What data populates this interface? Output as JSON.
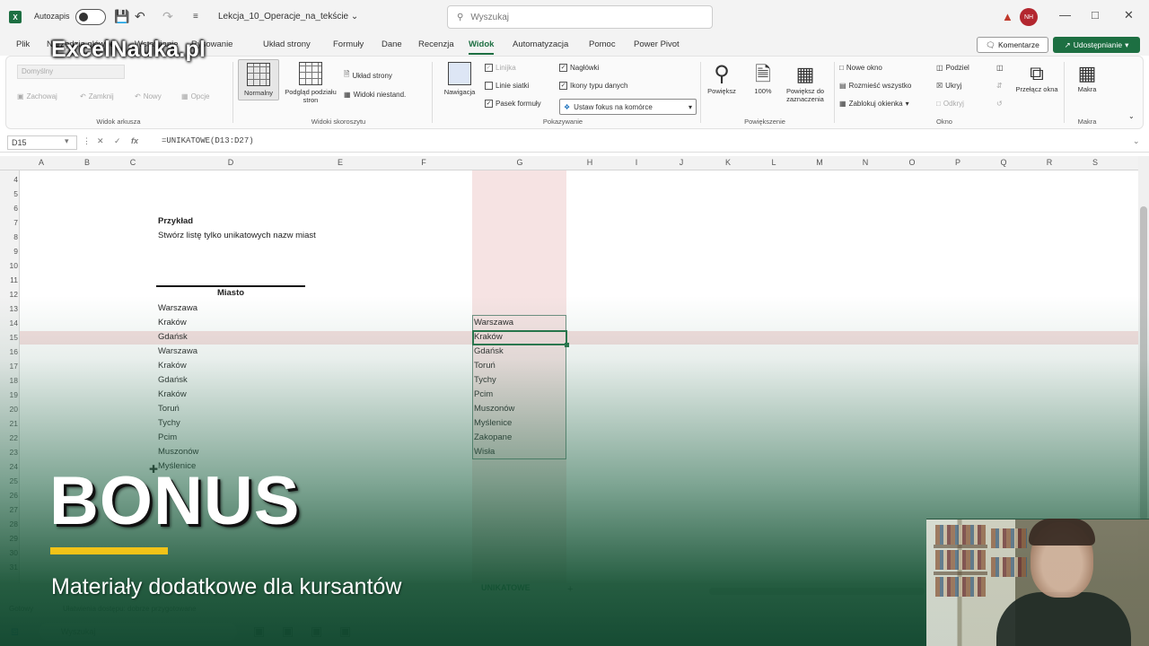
{
  "titlebar": {
    "autosave_label": "Autozapis",
    "filename": "Lekcja_10_Operacje_na_tekście ⌄",
    "search_placeholder": "Wyszukaj",
    "avatar_initials": "NH"
  },
  "tabs": [
    "Plik",
    "Narzędzia główne",
    "Wstawianie",
    "Rysowanie",
    "Układ strony",
    "Formuły",
    "Dane",
    "Recenzja",
    "Widok",
    "Automatyzacja",
    "Pomoc",
    "Power Pivot"
  ],
  "active_tab": "Widok",
  "actions": {
    "comments": "Komentarze",
    "share": "Udostępnianie"
  },
  "ribbon": {
    "sheet_view": {
      "dropdown": "Domyślny",
      "keep": "Zachowaj",
      "exit": "Zamknij",
      "new": "Nowy",
      "options": "Opcje",
      "label": "Widok arkusza"
    },
    "workbook_views": {
      "normal": "Normalny",
      "page_break": "Podgląd podziału stron",
      "page_layout": "Układ strony",
      "custom": "Widoki niestand.",
      "label": "Widoki skoroszytu"
    },
    "show": {
      "navigation": "Nawigacja",
      "ruler": "Linijka",
      "gridlines": "Linie siatki",
      "formula_bar": "Pasek formuły",
      "headings": "Nagłówki",
      "data_type_icons": "Ikony typu danych",
      "focus_cell": "Ustaw fokus na komórce",
      "label": "Pokazywanie"
    },
    "zoom": {
      "zoom": "Powiększ",
      "hundred": "100%",
      "to_selection": "Powiększ do zaznaczenia",
      "label": "Powiększenie"
    },
    "window": {
      "new_window": "Nowe okno",
      "arrange_all": "Rozmieść wszystko",
      "freeze_panes": "Zablokuj okienka",
      "split": "Podziel",
      "hide": "Ukryj",
      "unhide": "Odkryj",
      "switch_windows": "Przełącz okna",
      "label": "Okno"
    },
    "macros": {
      "macros": "Makra",
      "label": "Makra"
    }
  },
  "formula_bar": {
    "name_box": "D15",
    "formula": "=UNIKATOWE(D13:D27)"
  },
  "columns": [
    "A",
    "B",
    "C",
    "D",
    "E",
    "F",
    "G",
    "H",
    "I",
    "J",
    "K",
    "L",
    "M",
    "N",
    "O",
    "P",
    "Q",
    "R",
    "S"
  ],
  "rows": [
    "4",
    "5",
    "6",
    "7",
    "8",
    "9",
    "10",
    "11",
    "12",
    "13",
    "14",
    "15",
    "16",
    "17",
    "18",
    "19",
    "20",
    "21",
    "22",
    "23",
    "24",
    "25",
    "26",
    "27",
    "28",
    "29",
    "30",
    "31"
  ],
  "example": {
    "title": "Przykład",
    "instruction": "Stwórz listę tylko unikatowych nazw miast"
  },
  "table_header": "Miasto",
  "cities": [
    "Warszawa",
    "Kraków",
    "Gdańsk",
    "Warszawa",
    "Kraków",
    "Gdańsk",
    "Kraków",
    "Toruń",
    "Tychy",
    "Pcim",
    "Muszonów",
    "Myślenice"
  ],
  "unique_cities": [
    "Warszawa",
    "Kraków",
    "Gdańsk",
    "Toruń",
    "Tychy",
    "Pcim",
    "Muszonów",
    "Myślenice",
    "Zakopane",
    "Wisła"
  ],
  "sheet_tab": "UNIKATOWE",
  "status": {
    "ready": "Gotowy",
    "accessibility": "Ułatwienia dostępu: dobrze przygotowane"
  },
  "taskbar": {
    "search": "Wyszukaj"
  },
  "overlay": {
    "brand": "ExcelNauka.pl",
    "headline": "BONUS",
    "subtitle": "Materiały dodatkowe dla kursantów",
    "accent_color": "#f2c318",
    "gradient_color": "#14502f"
  }
}
